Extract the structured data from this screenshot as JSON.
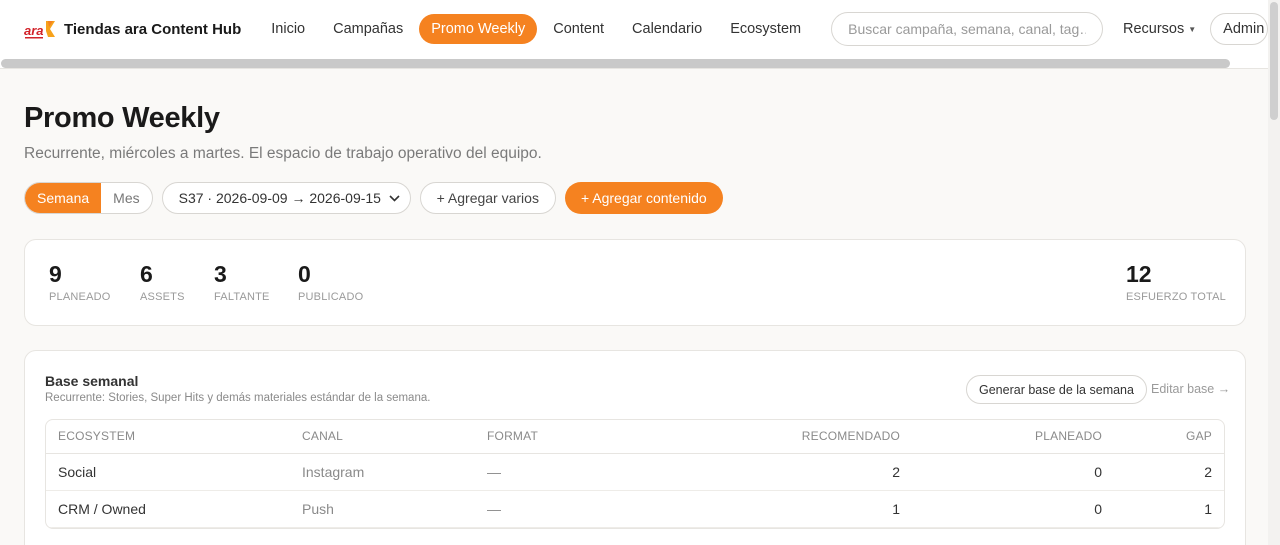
{
  "brand": {
    "name": "Tiendas ara Content Hub",
    "logo_text": "ara",
    "accent": "#f58220"
  },
  "nav": {
    "items": [
      {
        "label": "Inicio",
        "active": false
      },
      {
        "label": "Campañas",
        "active": false
      },
      {
        "label": "Promo Weekly",
        "active": true
      },
      {
        "label": "Content",
        "active": false
      },
      {
        "label": "Calendario",
        "active": false
      },
      {
        "label": "Ecosystem",
        "active": false
      }
    ],
    "search_placeholder": "Buscar campaña, semana, canal, tag…",
    "resources_label": "Recursos",
    "admin_label": "Admin"
  },
  "page": {
    "title": "Promo Weekly",
    "subtitle": "Recurrente, miércoles a martes. El espacio de trabajo operativo del equipo."
  },
  "controls": {
    "view_week": "Semana",
    "view_month": "Mes",
    "active_view": "Semana",
    "week_selected": "S37 · 2026-09-09 → 2026-09-15",
    "add_many": "+ Agregar varios",
    "add_content": "+ Agregar contenido"
  },
  "stats": [
    {
      "value": "9",
      "label": "PLANEADO"
    },
    {
      "value": "6",
      "label": "ASSETS"
    },
    {
      "value": "3",
      "label": "FALTANTE"
    },
    {
      "value": "0",
      "label": "PUBLICADO"
    },
    {
      "value": "12",
      "label": "ESFUERZO TOTAL"
    }
  ],
  "base": {
    "title": "Base semanal",
    "description": "Recurrente: Stories, Super Hits y demás materiales estándar de la semana.",
    "generate_label": "Generar base de la semana",
    "edit_label": "Editar base →",
    "columns": [
      "ECOSYSTEM",
      "CANAL",
      "FORMAT",
      "RECOMENDADO",
      "PLANEADO",
      "GAP"
    ],
    "rows": [
      {
        "ecosystem": "Social",
        "canal": "Instagram",
        "format": "—",
        "recomendado": "2",
        "planeado": "0",
        "gap": "2"
      },
      {
        "ecosystem": "CRM / Owned",
        "canal": "Push",
        "format": "—",
        "recomendado": "1",
        "planeado": "0",
        "gap": "1"
      }
    ]
  },
  "icons": {
    "select_chevron": "chevron-down-icon",
    "resources_caret": "caret-down-icon"
  }
}
